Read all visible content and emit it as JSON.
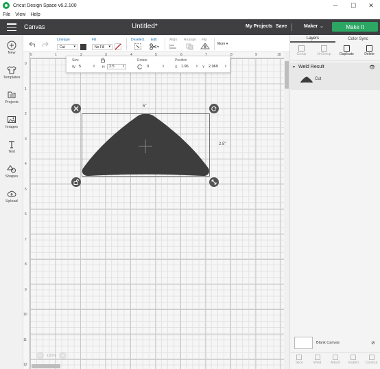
{
  "window": {
    "title": "Cricut Design Space  v6.2.100",
    "minimize_glyph": "─",
    "maximize_glyph": "☐",
    "close_glyph": "✕"
  },
  "menubar": [
    "File",
    "View",
    "Help"
  ],
  "header": {
    "section": "Canvas",
    "project_title": "Untitled*",
    "my_projects": "My Projects",
    "save": "Save",
    "machine": "Maker",
    "machine_chevron": "⌄",
    "make_it": "Make It"
  },
  "sidebar": {
    "items": [
      {
        "label": "New",
        "icon": "plus-circle-icon"
      },
      {
        "label": "Templates",
        "icon": "shirt-icon"
      },
      {
        "label": "Projects",
        "icon": "folder-icon"
      },
      {
        "label": "Images",
        "icon": "image-icon"
      },
      {
        "label": "Text",
        "icon": "text-icon"
      },
      {
        "label": "Shapes",
        "icon": "shapes-icon"
      },
      {
        "label": "Upload",
        "icon": "cloud-upload-icon"
      }
    ]
  },
  "edit_toolbar": {
    "linetype_label": "Linetype",
    "linetype_value": "Cut",
    "fill_label": "Fill",
    "fill_value": "No Fill",
    "deselect": "Deselect",
    "edit": "Edit",
    "align": "Align",
    "arrange": "Arrange",
    "flip": "Flip",
    "more": "More ▾",
    "swatch_color": "#3d3d3d"
  },
  "size_panel": {
    "size_label": "Size",
    "w_label": "W",
    "w_value": "5",
    "h_label": "H",
    "h_value": "2.5",
    "rotate_label": "Rotate",
    "rotate_value": "0",
    "position_label": "Position",
    "x_label": "X",
    "x_value": "1.96",
    "y_label": "Y",
    "y_value": "2.069",
    "step_glyph": "⇕"
  },
  "canvas": {
    "ruler_top": [
      "0",
      "1",
      "2",
      "3",
      "4",
      "5",
      "6",
      "7",
      "8",
      "9",
      "10"
    ],
    "ruler_left": [
      "0",
      "1",
      "2",
      "3",
      "4",
      "5",
      "6",
      "7",
      "8",
      "9",
      "10",
      "11",
      "12"
    ],
    "width_dim": "5\"",
    "height_dim": "2.5\"",
    "shape_color": "#3d3d3d",
    "zoom_minus": "−",
    "zoom_value": "100%",
    "zoom_plus": "+"
  },
  "layers_panel": {
    "tabs": [
      "Layers",
      "Color Sync"
    ],
    "actions": [
      "Group",
      "UnGroup",
      "Duplicate",
      "Delete"
    ],
    "group_caret": "▾",
    "group_name": "Weld Result",
    "visibility_glyph": "👁",
    "layer_name": "Cut",
    "blank_canvas": "Blank Canvas",
    "blank_canvas_visibility_glyph": "⊘",
    "bottom_actions": [
      "Slice",
      "Weld",
      "Attach",
      "Flatten",
      "Contour"
    ]
  }
}
